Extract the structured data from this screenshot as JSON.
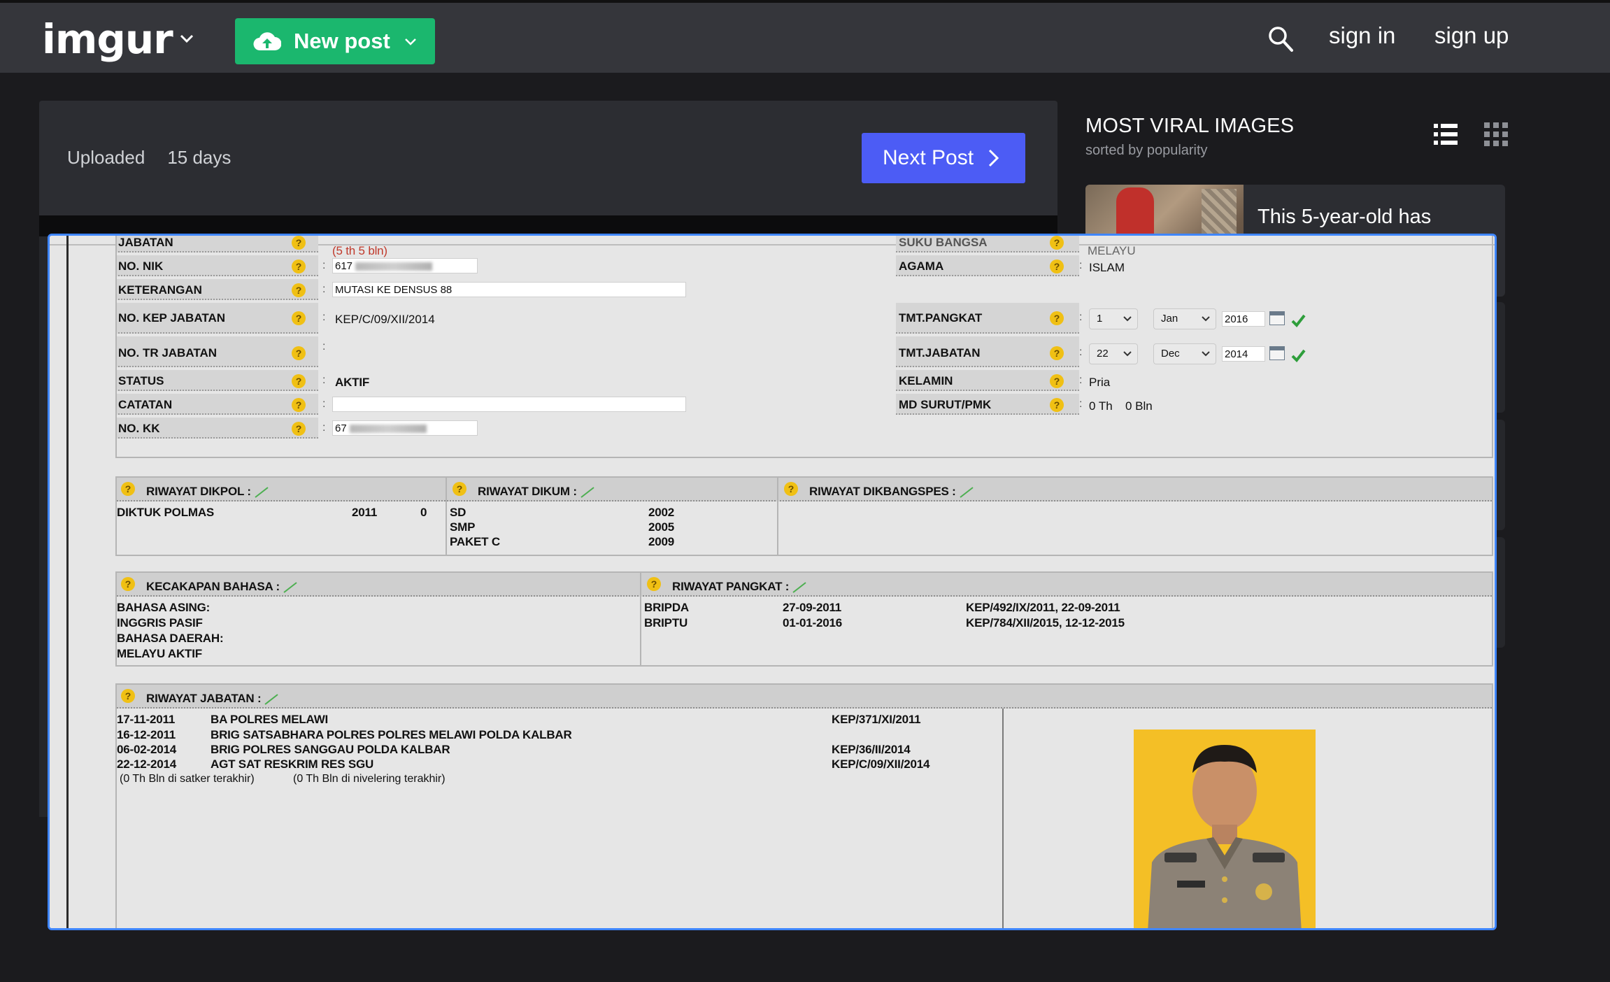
{
  "topbar": {
    "logo": "imgur",
    "new_post": "New post",
    "sign_in": "sign in",
    "sign_up": "sign up"
  },
  "post": {
    "uploaded_label": "Uploaded",
    "uploaded_ago": "15 days",
    "next_post": "Next Post"
  },
  "sidebar": {
    "title": "MOST VIRAL IMAGES",
    "subtitle": "sorted by popularity",
    "card_title": "This 5-year-old has"
  },
  "doc": {
    "jabatan": "JABATAN",
    "jabatan_value": "(5 th 5 bln)",
    "suku_bangsa": "SUKU BANGSA",
    "suku_value": "MELAYU",
    "nik": "NO. NIK",
    "nik_value": "617",
    "agama": "AGAMA",
    "agama_value": "ISLAM",
    "keterangan": "KETERANGAN",
    "keterangan_value": "MUTASI KE DENSUS 88",
    "kep_jabatan": "NO. KEP JABATAN",
    "kep_jabatan_value": "KEP/C/09/XII/2014",
    "tmt_pangkat": "TMT.PANGKAT",
    "tmt_pangkat_day": "1",
    "tmt_pangkat_month": "Jan",
    "tmt_pangkat_year": "2016",
    "tr_jabatan": "NO. TR JABATAN",
    "tmt_jabatan": "TMT.JABATAN",
    "tmt_jabatan_day": "22",
    "tmt_jabatan_month": "Dec",
    "tmt_jabatan_year": "2014",
    "status": "STATUS",
    "status_value": "AKTIF",
    "kelamin": "KELAMIN",
    "kelamin_value": "Pria",
    "catatan": "CATATAN",
    "md_surut": "MD SURUT/PMK",
    "md_surut_th": "0 Th",
    "md_surut_bln": "0 Bln",
    "kk": "NO. KK",
    "kk_value": "67",
    "dikpol_title": "RIWAYAT DIKPOL :",
    "dikpol_name": "DIKTUK POLMAS",
    "dikpol_year": "2011",
    "dikpol_num": "0",
    "dikum_title": "RIWAYAT DIKUM :",
    "dikum_rows": [
      {
        "name": "SD",
        "year": "2002"
      },
      {
        "name": "SMP",
        "year": "2005"
      },
      {
        "name": "PAKET C",
        "year": "2009"
      }
    ],
    "dikbangspes_title": "RIWAYAT DIKBANGSPES :",
    "bahasa_title": "KECAKAPAN BAHASA :",
    "bahasa_lines": [
      "BAHASA ASING:",
      "INGGRIS PASIF",
      "BAHASA DAERAH:",
      "MELAYU AKTIF"
    ],
    "pangkat_title": "RIWAYAT PANGKAT :",
    "pangkat_rows": [
      {
        "rank": "BRIPDA",
        "date": "27-09-2011",
        "kep": "KEP/492/IX/2011, 22-09-2011"
      },
      {
        "rank": "BRIPTU",
        "date": "01-01-2016",
        "kep": "KEP/784/XII/2015, 12-12-2015"
      }
    ],
    "jabatan_title": "RIWAYAT JABATAN :",
    "jabatan_rows": [
      {
        "date": "17-11-2011",
        "pos": "BA POLRES MELAWI",
        "kep": "KEP/371/XI/2011"
      },
      {
        "date": "16-12-2011",
        "pos": "BRIG SATSABHARA POLRES POLRES MELAWI POLDA KALBAR",
        "kep": ""
      },
      {
        "date": "06-02-2014",
        "pos": "BRIG POLRES SANGGAU POLDA KALBAR",
        "kep": "KEP/36/II/2014"
      },
      {
        "date": "22-12-2014",
        "pos": "AGT SAT RESKRIM RES SGU",
        "kep": "KEP/C/09/XII/2014"
      }
    ],
    "satker_note": "(0 Th Bln di satker terakhir)",
    "nivelering_note": "(0 Th Bln di nivelering terakhir)"
  }
}
